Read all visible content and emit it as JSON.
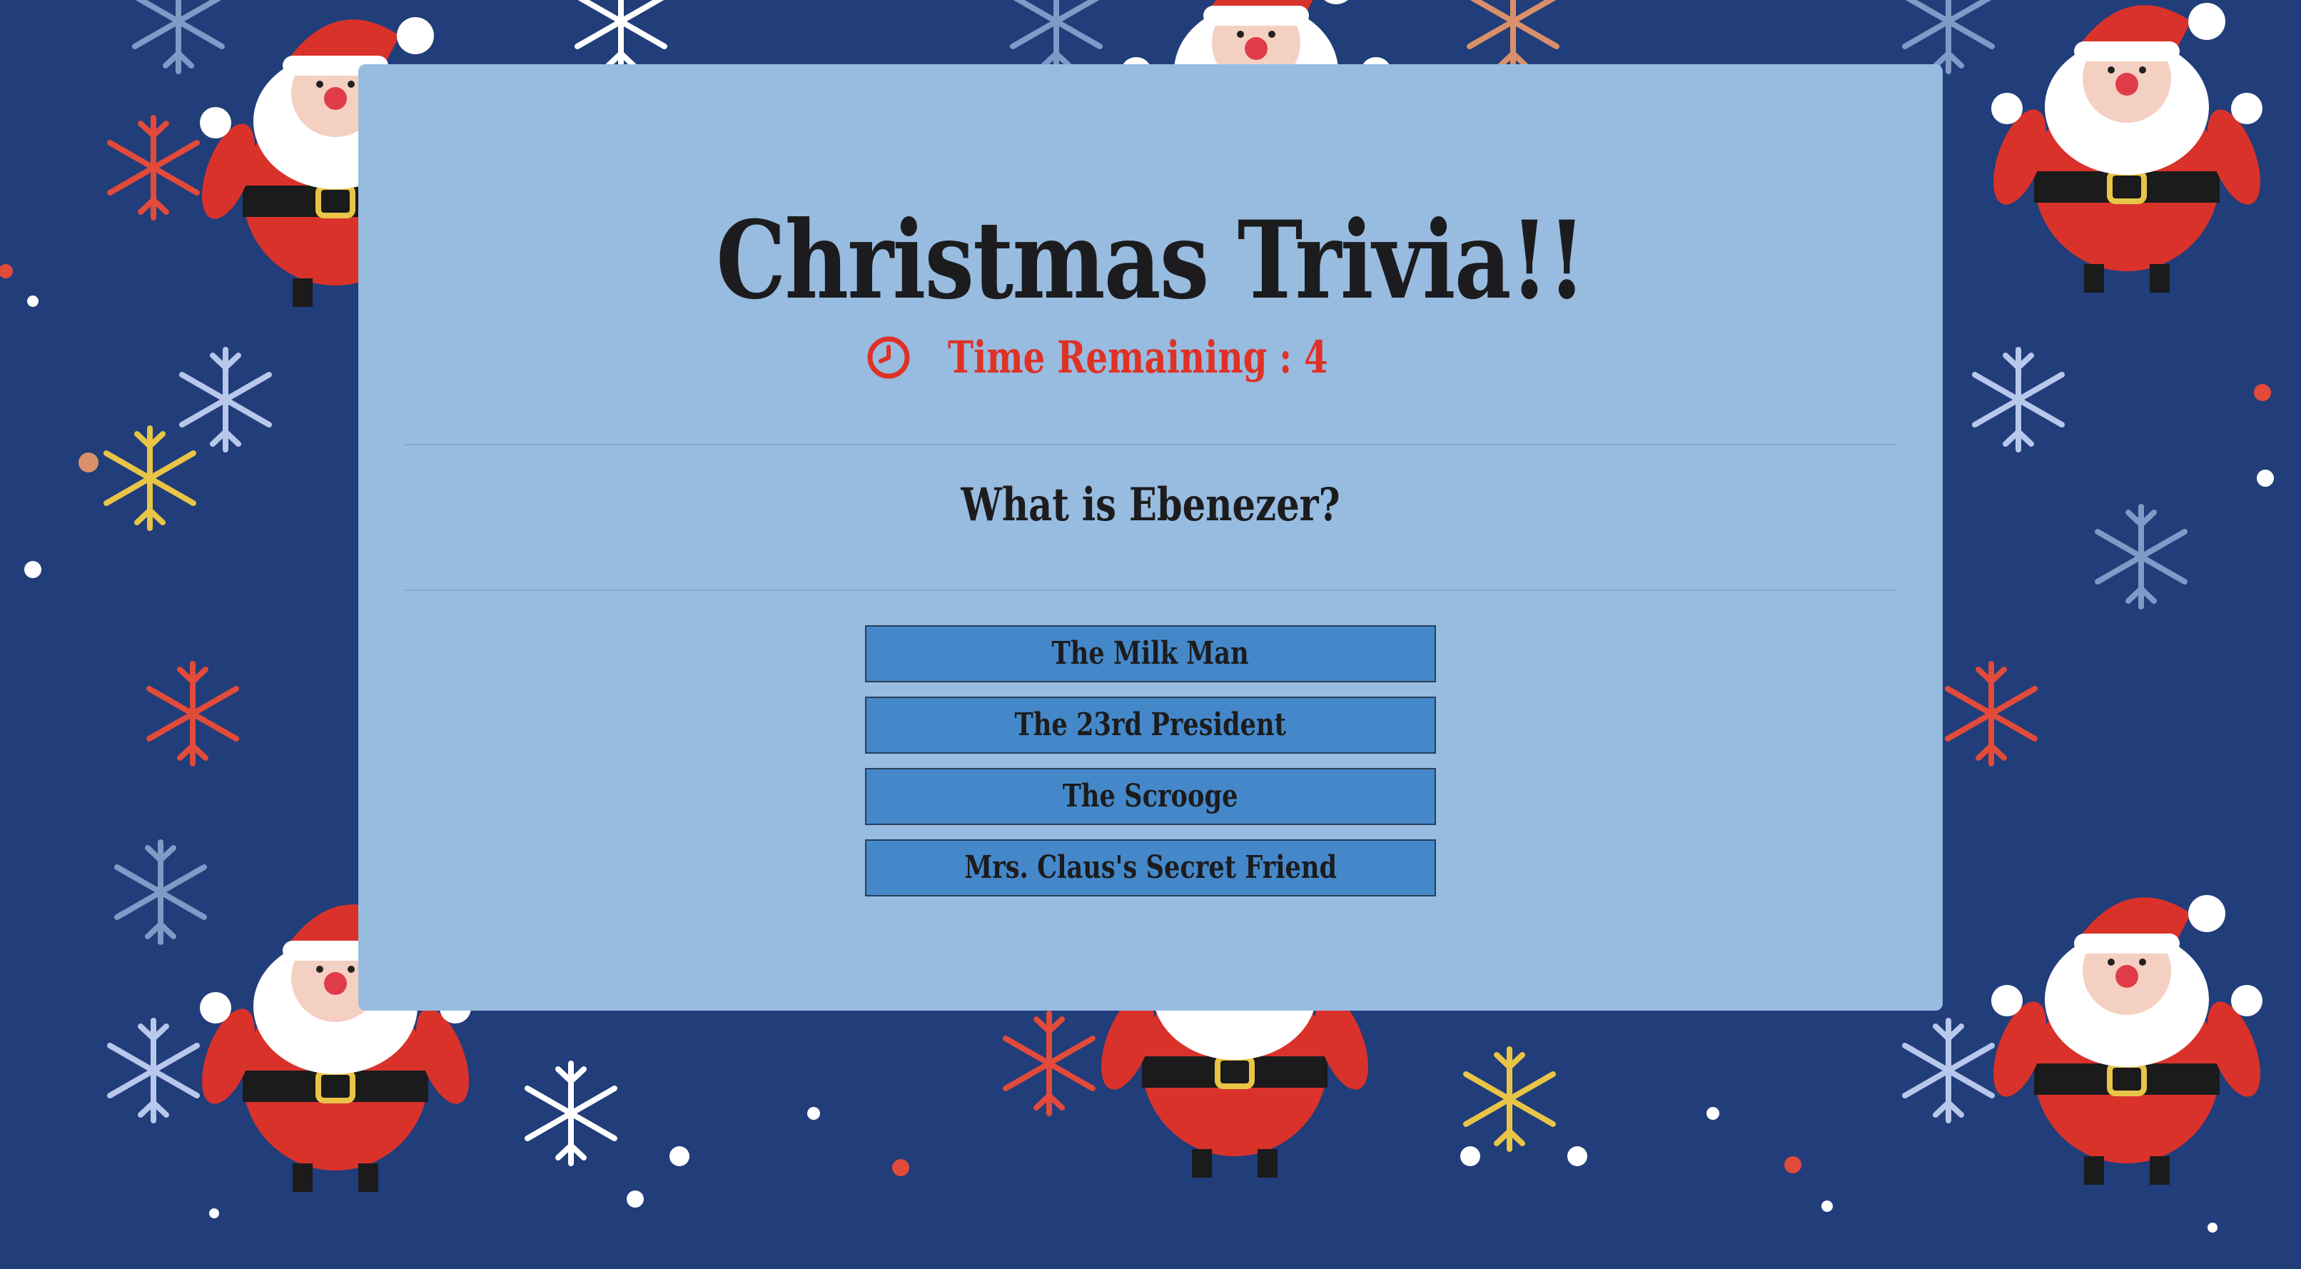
{
  "page": {
    "title": "Christmas Trivia!!"
  },
  "timer": {
    "label": "Time Remaining : 4",
    "icon": "clock-icon",
    "color": "#de3226"
  },
  "question": {
    "text": "What is Ebenezer?"
  },
  "answers": [
    {
      "label": "The Milk Man"
    },
    {
      "label": "The 23rd President"
    },
    {
      "label": "The Scrooge"
    },
    {
      "label": "Mrs. Claus's Secret Friend"
    }
  ],
  "theme": {
    "background": "#213d7a",
    "card": "#98bbe0",
    "button": "#4588c9"
  }
}
